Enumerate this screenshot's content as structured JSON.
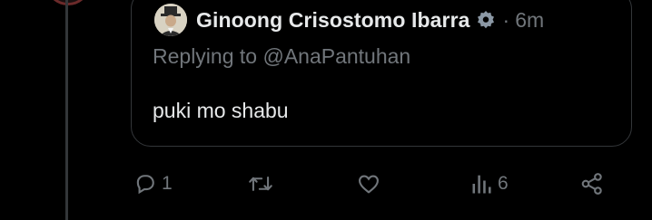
{
  "quote": {
    "display_name": "Ginoong Crisostomo Ibarra",
    "separator": "·",
    "timestamp": "6m",
    "replying_prefix": "Replying to ",
    "replying_handle": "@AnaPantuhan",
    "text": "puki mo shabu"
  },
  "actions": {
    "reply_count": "1",
    "retweet_count": "",
    "like_count": "",
    "views_count": "6"
  },
  "icons": {
    "reply": "reply-icon",
    "retweet": "retweet-icon",
    "like": "heart-icon",
    "views": "views-icon",
    "share": "share-icon",
    "badge": "verified-badge-icon"
  },
  "colors": {
    "background": "#000000",
    "primary_text": "#e7e9ea",
    "secondary_text": "#71767b",
    "border": "#333639",
    "thread_line": "#333639"
  }
}
